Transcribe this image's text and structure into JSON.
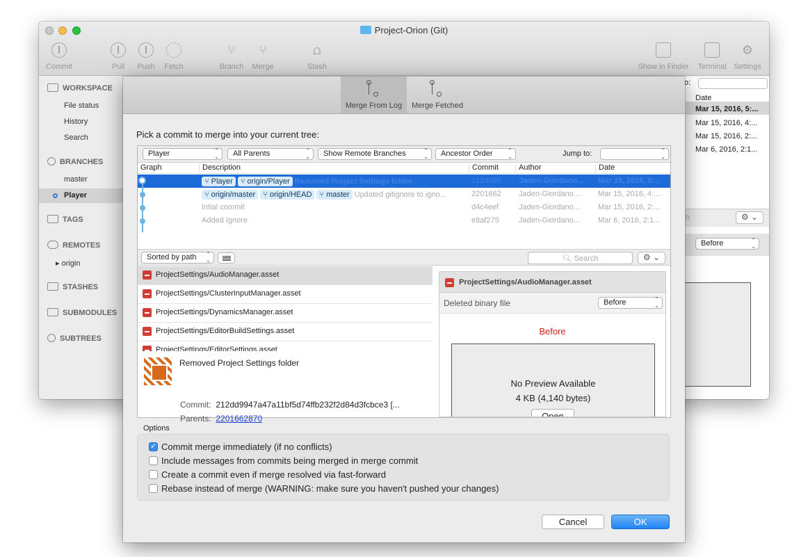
{
  "window": {
    "title": "Project-Orion (Git)"
  },
  "toolbar": {
    "commit": "Commit",
    "pull": "Pull",
    "push": "Push",
    "fetch": "Fetch",
    "branch": "Branch",
    "merge": "Merge",
    "stash": "Stash",
    "show_in_finder": "Show in Finder",
    "terminal": "Terminal",
    "settings": "Settings"
  },
  "sidebar": {
    "workspace": "WORKSPACE",
    "file_status": "File status",
    "history": "History",
    "search": "Search",
    "branches": "BRANCHES",
    "master": "master",
    "player": "Player",
    "tags": "TAGS",
    "remotes": "REMOTES",
    "origin": "origin",
    "stashes": "STASHES",
    "submodules": "SUBMODULES",
    "subtrees": "SUBTREES"
  },
  "background": {
    "jump_label": "o:",
    "date_header": "Date",
    "dates": [
      "Mar 15, 2016, 5:...",
      "Mar 15, 2016, 4:...",
      "Mar 15, 2016, 2:...",
      "Mar 6, 2016, 2:1..."
    ],
    "search_hint": "h",
    "before_select": "Before"
  },
  "sheet": {
    "tab_merge_from_log": "Merge From Log",
    "tab_merge_fetched": "Merge Fetched",
    "prompt": "Pick a commit to merge into your current tree:",
    "filters": {
      "branch": "Player",
      "parents": "All Parents",
      "remote": "Show Remote Branches",
      "order": "Ancestor Order",
      "jump_to": "Jump to:"
    },
    "columns": {
      "graph": "Graph",
      "description": "Description",
      "commit": "Commit",
      "author": "Author",
      "date": "Date"
    },
    "commits": [
      {
        "tags": [
          "Player",
          "origin/Player"
        ],
        "description": "Removed Project Settings folder",
        "hash": "212dd99",
        "author": "Jaden-Giordano...",
        "date": "Mar 15, 2016, 5:..."
      },
      {
        "tags": [
          "origin/master",
          "origin/HEAD",
          "master"
        ],
        "description": "Updated gitignore to igno...",
        "hash": "2201662",
        "author": "Jaden-Giordano...",
        "date": "Mar 15, 2016, 4:..."
      },
      {
        "tags": [],
        "description": "Intial commit",
        "hash": "d4c4eef",
        "author": "Jaden-Giordano...",
        "date": "Mar 15, 2016, 2:..."
      },
      {
        "tags": [],
        "description": "Added Ignore",
        "hash": "e8af275",
        "author": "Jaden-Giordano...",
        "date": "Mar 6, 2016, 2:1..."
      }
    ],
    "sort": "Sorted by path",
    "search_placeholder": "Search",
    "files": [
      "ProjectSettings/AudioManager.asset",
      "ProjectSettings/ClusterInputManager.asset",
      "ProjectSettings/DynamicsManager.asset",
      "ProjectSettings/EditorBuildSettings.asset",
      "ProjectSettings/EditorSettings.asset"
    ],
    "commit_info": {
      "message": "Removed Project Settings folder",
      "commit_label": "Commit:",
      "commit_value": "212dd9947a47a11bf5d74ffb232f2d84d3fcbce3 [...",
      "parents_label": "Parents:",
      "parents_value": "2201662870"
    },
    "diff": {
      "file": "ProjectSettings/AudioManager.asset",
      "status": "Deleted binary file",
      "mode": "Before",
      "before_label": "Before",
      "no_preview": "No Preview Available",
      "size": "4 KB (4,140 bytes)",
      "open": "Open"
    },
    "options_label": "Options",
    "options": [
      {
        "label": "Commit merge immediately (if no conflicts)",
        "checked": true
      },
      {
        "label": "Include messages from commits being merged in merge commit",
        "checked": false
      },
      {
        "label": "Create a commit even if merge resolved via fast-forward",
        "checked": false
      },
      {
        "label": "Rebase instead of merge (WARNING: make sure you haven't pushed your changes)",
        "checked": false
      }
    ],
    "cancel": "Cancel",
    "ok": "OK"
  },
  "icons": {
    "commit": "commit-icon",
    "pull": "pull-icon",
    "push": "push-icon",
    "fetch": "fetch-icon",
    "branch": "branch-icon",
    "merge": "merge-icon",
    "stash": "stash-icon",
    "finder": "finder-icon",
    "terminal": "terminal-icon",
    "settings": "gear-icon"
  }
}
